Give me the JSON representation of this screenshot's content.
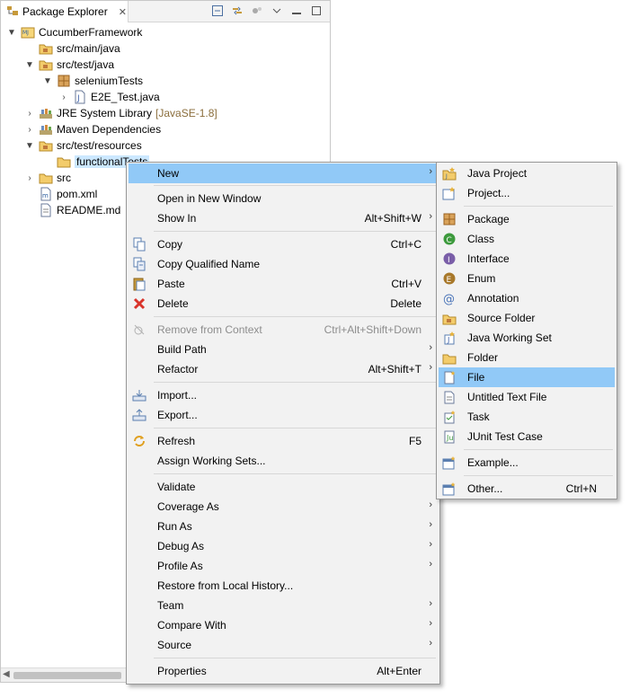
{
  "view": {
    "title": "Package Explorer",
    "close_glyph": "✕"
  },
  "tree": [
    {
      "label": "CucumberFramework",
      "icon": "project-icon",
      "expanded": true
    },
    {
      "label": "src/main/java",
      "icon": "source-folder-icon"
    },
    {
      "label": "src/test/java",
      "icon": "source-folder-icon",
      "expanded": true
    },
    {
      "label": "seleniumTests",
      "icon": "package-icon",
      "expanded": true
    },
    {
      "label": "E2E_Test.java",
      "icon": "java-file-icon"
    },
    {
      "label": "JRE System Library",
      "suffix": "[JavaSE-1.8]",
      "icon": "library-icon"
    },
    {
      "label": "Maven Dependencies",
      "icon": "library-icon"
    },
    {
      "label": "src/test/resources",
      "icon": "source-folder-icon",
      "expanded": true
    },
    {
      "label": "functionalTests",
      "icon": "folder-icon",
      "selected": true
    },
    {
      "label": "src",
      "icon": "folder-icon"
    },
    {
      "label": "pom.xml",
      "icon": "xml-file-icon"
    },
    {
      "label": "README.md",
      "icon": "text-file-icon"
    }
  ],
  "context_menu": {
    "items": [
      {
        "label": "New",
        "submenu": true,
        "highlighted": true
      },
      {
        "label": "Open in New Window"
      },
      {
        "label": "Show In",
        "shortcut": "Alt+Shift+W",
        "submenu": true
      },
      {
        "label": "Copy",
        "shortcut": "Ctrl+C",
        "icon": "copy-icon"
      },
      {
        "label": "Copy Qualified Name",
        "icon": "copy-qualified-icon"
      },
      {
        "label": "Paste",
        "shortcut": "Ctrl+V",
        "icon": "paste-icon"
      },
      {
        "label": "Delete",
        "shortcut": "Delete",
        "icon": "delete-icon"
      },
      {
        "label": "Remove from Context",
        "shortcut": "Ctrl+Alt+Shift+Down",
        "disabled": true,
        "icon": "remove-context-icon"
      },
      {
        "label": "Build Path",
        "submenu": true
      },
      {
        "label": "Refactor",
        "shortcut": "Alt+Shift+T",
        "submenu": true
      },
      {
        "label": "Import...",
        "icon": "import-icon"
      },
      {
        "label": "Export...",
        "icon": "export-icon"
      },
      {
        "label": "Refresh",
        "shortcut": "F5",
        "icon": "refresh-icon"
      },
      {
        "label": "Assign Working Sets..."
      },
      {
        "label": "Validate"
      },
      {
        "label": "Coverage As",
        "submenu": true
      },
      {
        "label": "Run As",
        "submenu": true
      },
      {
        "label": "Debug As",
        "submenu": true
      },
      {
        "label": "Profile As",
        "submenu": true
      },
      {
        "label": "Restore from Local History..."
      },
      {
        "label": "Team",
        "submenu": true
      },
      {
        "label": "Compare With",
        "submenu": true
      },
      {
        "label": "Source",
        "submenu": true
      },
      {
        "label": "Properties",
        "shortcut": "Alt+Enter"
      }
    ]
  },
  "new_submenu": {
    "items": [
      {
        "label": "Java Project",
        "icon": "java-project-icon"
      },
      {
        "label": "Project...",
        "icon": "project-wizard-icon"
      },
      {
        "label": "Package",
        "icon": "package-icon"
      },
      {
        "label": "Class",
        "icon": "class-icon"
      },
      {
        "label": "Interface",
        "icon": "interface-icon"
      },
      {
        "label": "Enum",
        "icon": "enum-icon"
      },
      {
        "label": "Annotation",
        "icon": "annotation-icon"
      },
      {
        "label": "Source Folder",
        "icon": "source-folder-icon"
      },
      {
        "label": "Java Working Set",
        "icon": "working-set-icon"
      },
      {
        "label": "Folder",
        "icon": "folder-icon"
      },
      {
        "label": "File",
        "icon": "file-icon",
        "highlighted": true
      },
      {
        "label": "Untitled Text File",
        "icon": "text-file-icon"
      },
      {
        "label": "Task",
        "icon": "task-icon"
      },
      {
        "label": "JUnit Test Case",
        "icon": "junit-icon"
      },
      {
        "label": "Example...",
        "icon": "example-icon"
      },
      {
        "label": "Other...",
        "shortcut": "Ctrl+N",
        "icon": "other-icon"
      }
    ]
  },
  "colors": {
    "highlight": "#91c9f7",
    "selection": "#cce8ff",
    "menu_bg": "#f2f2f2",
    "library_suffix": "#8a6d3b"
  }
}
